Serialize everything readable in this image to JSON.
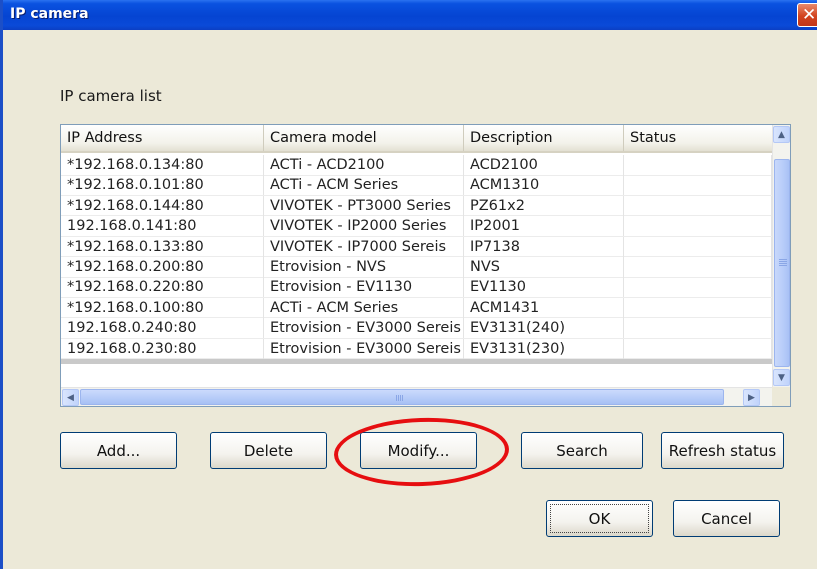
{
  "window": {
    "title": "IP camera"
  },
  "list": {
    "label": "IP camera list",
    "columns": [
      "IP Address",
      "Camera model",
      "Description",
      "Status"
    ],
    "rows": [
      {
        "ip": "*192.168.0.134:80",
        "model": "ACTi - ACD2100",
        "desc": "ACD2100",
        "status": ""
      },
      {
        "ip": "*192.168.0.101:80",
        "model": "ACTi - ACM Series",
        "desc": "ACM1310",
        "status": ""
      },
      {
        "ip": "*192.168.0.144:80",
        "model": "VIVOTEK - PT3000 Series",
        "desc": "PZ61x2",
        "status": ""
      },
      {
        "ip": "192.168.0.141:80",
        "model": "VIVOTEK - IP2000 Series",
        "desc": "IP2001",
        "status": ""
      },
      {
        "ip": "*192.168.0.133:80",
        "model": "VIVOTEK - IP7000 Sereis",
        "desc": "IP7138",
        "status": ""
      },
      {
        "ip": "*192.168.0.200:80",
        "model": "Etrovision - NVS",
        "desc": "NVS",
        "status": ""
      },
      {
        "ip": "*192.168.0.220:80",
        "model": "Etrovision - EV1130",
        "desc": "EV1130",
        "status": ""
      },
      {
        "ip": "*192.168.0.100:80",
        "model": "ACTi - ACM Series",
        "desc": "ACM1431",
        "status": ""
      },
      {
        "ip": "192.168.0.240:80",
        "model": "Etrovision - EV3000 Sereis",
        "desc": "EV3131(240)",
        "status": ""
      },
      {
        "ip": "192.168.0.230:80",
        "model": "Etrovision - EV3000 Sereis",
        "desc": "EV3131(230)",
        "status": ""
      }
    ]
  },
  "buttons": {
    "add": "Add...",
    "delete": "Delete",
    "modify": "Modify...",
    "search": "Search",
    "refresh": "Refresh status",
    "ok": "OK",
    "cancel": "Cancel"
  },
  "icons": {
    "close": "close-icon",
    "scroll_up": "chevron-up-icon",
    "scroll_down": "chevron-down-icon",
    "scroll_left": "chevron-left-icon",
    "scroll_right": "chevron-right-icon"
  },
  "colors": {
    "titlebar": "#0544d2",
    "dialog_bg": "#ece9d8",
    "highlight_ellipse": "#e60e10"
  }
}
